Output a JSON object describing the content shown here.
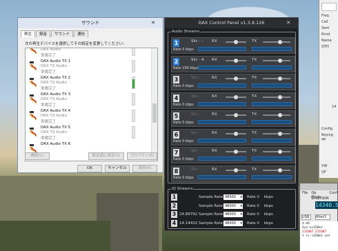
{
  "sound_dialog": {
    "title": "サウンド",
    "close": "✕",
    "tabs": [
      "再生",
      "録音",
      "サウンド",
      "通信"
    ],
    "description": "次の再生デバイスを選択してその設定を変更してください:",
    "devices": [
      {
        "name": "",
        "sub": "DAX Audio",
        "status": "準備完了"
      },
      {
        "name": "DAX Audio TX 1",
        "sub": "DAX TX Audio",
        "status": "準備完了"
      },
      {
        "name": "DAX Audio TX 2",
        "sub": "DAX TX Audio",
        "status": "準備完了"
      },
      {
        "name": "DAX Audio TX 3",
        "sub": "DAX TX Audio",
        "status": "準備完了"
      },
      {
        "name": "DAX Audio TX 4",
        "sub": "DAX TX Audio",
        "status": "準備完了"
      },
      {
        "name": "DAX Audio TX 5",
        "sub": "DAX TX Audio",
        "status": "準備完了"
      },
      {
        "name": "DAX Audio TX 6",
        "sub": "",
        "status": ""
      }
    ],
    "buttons": {
      "configure": "構成(C)",
      "set_default": "既定値に設定(S)",
      "properties": "プロパティ(P)",
      "ok": "OK",
      "cancel": "キャンセル",
      "apply": "適用(A)"
    }
  },
  "dax": {
    "title": "DAX Control Panel v1.3.8.126",
    "close": "✕",
    "audio_group": "Audio Streams",
    "iq_group": "IQ Streams",
    "slice_label": "Slic",
    "rx_label": "RX",
    "tx_label": "TX",
    "rate_label": "Rate",
    "kbps": "kbps",
    "rows": [
      {
        "num": "1",
        "slice": "-",
        "rate": "0",
        "active": true
      },
      {
        "num": "2",
        "slice": "A",
        "rate": "158",
        "active": true
      },
      {
        "num": "3",
        "slice": "-",
        "rate": "0",
        "active": false
      },
      {
        "num": "4",
        "slice": "-",
        "rate": "0",
        "active": false
      },
      {
        "num": "5",
        "slice": "-",
        "rate": "0",
        "active": false
      },
      {
        "num": "6",
        "slice": "-",
        "rate": "0",
        "active": false
      },
      {
        "num": "7",
        "slice": "-",
        "rate": "0",
        "active": false
      },
      {
        "num": "8",
        "slice": "-",
        "rate": "0",
        "active": false
      }
    ],
    "iq": [
      {
        "num": "1",
        "freq": "",
        "sample_rate": "48000",
        "rate": "0"
      },
      {
        "num": "2",
        "freq": "",
        "sample_rate": "48000",
        "rate": "0"
      },
      {
        "num": "3",
        "freq": "24.89792",
        "sample_rate": "48000",
        "rate": "0"
      },
      {
        "num": "4",
        "freq": "14.14432",
        "sample_rate": "48000",
        "rate": "0"
      }
    ],
    "sample_rate_label": "Sample Rate:"
  },
  "right_panel": {
    "items": [
      "Freq",
      "Call",
      "Sent",
      "Rcvd",
      "Name",
      "QTH",
      "14",
      "Config",
      "Keying ap",
      "VW",
      "QF"
    ]
  },
  "sdr": {
    "menu": [
      "File",
      "Op Mode",
      "Conf"
    ],
    "title": "SmartSDR",
    "usb": "USB",
    "filter": "filter3",
    "freq": "14340.58",
    "term_lines": [
      "$ m6",
      "Ace'n<350kt",
      "211007 211007",
      "t rs <350kt set"
    ]
  }
}
